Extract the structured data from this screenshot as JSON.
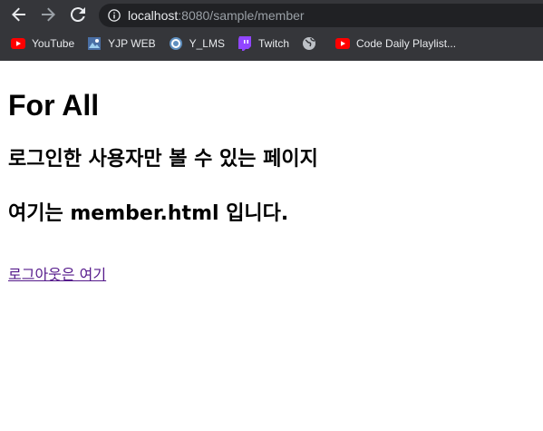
{
  "browser": {
    "url_host": "localhost",
    "url_rest": ":8080/sample/member",
    "bookmarks": [
      {
        "label": "YouTube",
        "icon": "youtube-icon"
      },
      {
        "label": "YJP WEB",
        "icon": "yjp-web-icon"
      },
      {
        "label": "Y_LMS",
        "icon": "lms-icon"
      },
      {
        "label": "Twitch",
        "icon": "twitch-icon"
      },
      {
        "label": "",
        "icon": "globe-icon"
      },
      {
        "label": "Code Daily Playlist...",
        "icon": "youtube-icon"
      }
    ]
  },
  "page": {
    "title": "For All",
    "subtitle": "로그인한 사용자만 볼 수 있는 페이지",
    "description": "여기는 member.html 입니다.",
    "logout_link": "로그아웃은 여기"
  },
  "colors": {
    "chrome_bg": "#35363a",
    "omnibox_bg": "#202124",
    "link_visited": "#551a8b"
  }
}
